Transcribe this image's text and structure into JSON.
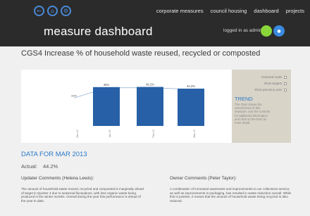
{
  "header": {
    "nav": [
      "corporate measures",
      "council housing",
      "dashboard",
      "projects"
    ],
    "title": "measure dashboard",
    "login_text": "logged in as admin",
    "colors": {
      "background": "#2b2b2b",
      "accent_green": "#8ad63a",
      "accent_blue": "#3a8ae0",
      "icon_blue": "#4a8ad8"
    }
  },
  "page": {
    "title": "CGS4 Increase % of household waste reused, recycled or composted"
  },
  "chart_data": {
    "type": "bar",
    "categories": [
      "Jan-13",
      "Feb-13",
      "Mar-13"
    ],
    "bar_values": [
      46.0,
      46.2,
      44.2
    ],
    "bar_labels": [
      "46%",
      "46.2%",
      "44.2%"
    ],
    "line_start_label": "33%",
    "line_start_value": 33,
    "ylim": [
      0,
      60
    ],
    "bar_color": "#2760a6",
    "line_color": "#9bb8d8"
  },
  "side_panel": {
    "options": [
      "reversed scale",
      "show targets",
      "show previous year"
    ],
    "trend_title": "TREND",
    "trend_text": "The chart shows the overall trend of this measure. Use the controls for additional information and click on the bars for more detail."
  },
  "data": {
    "title": "DATA FOR MAR 2013",
    "actual_label": "Actual:",
    "actual_value": "44.2%",
    "updater_label": "Updater Comments (Helena Lewis):",
    "updater_text": "The amount of household waste reused, recycled and composted is marginally ahead of target in Quarter 4 due to seasonal fluctuations, with less organic waste being produced in the winter months. Overall during the year this performance is ahead of the year to date.",
    "owner_label": "Owner Comments (Peter Taylor):",
    "owner_text": "A combination of increased awareness and improvements to our collections service, as well as improvements in packaging, has resulted in waste reduction overall. While this is positive, it means that the amount of household waste being recycled is also reduced."
  }
}
